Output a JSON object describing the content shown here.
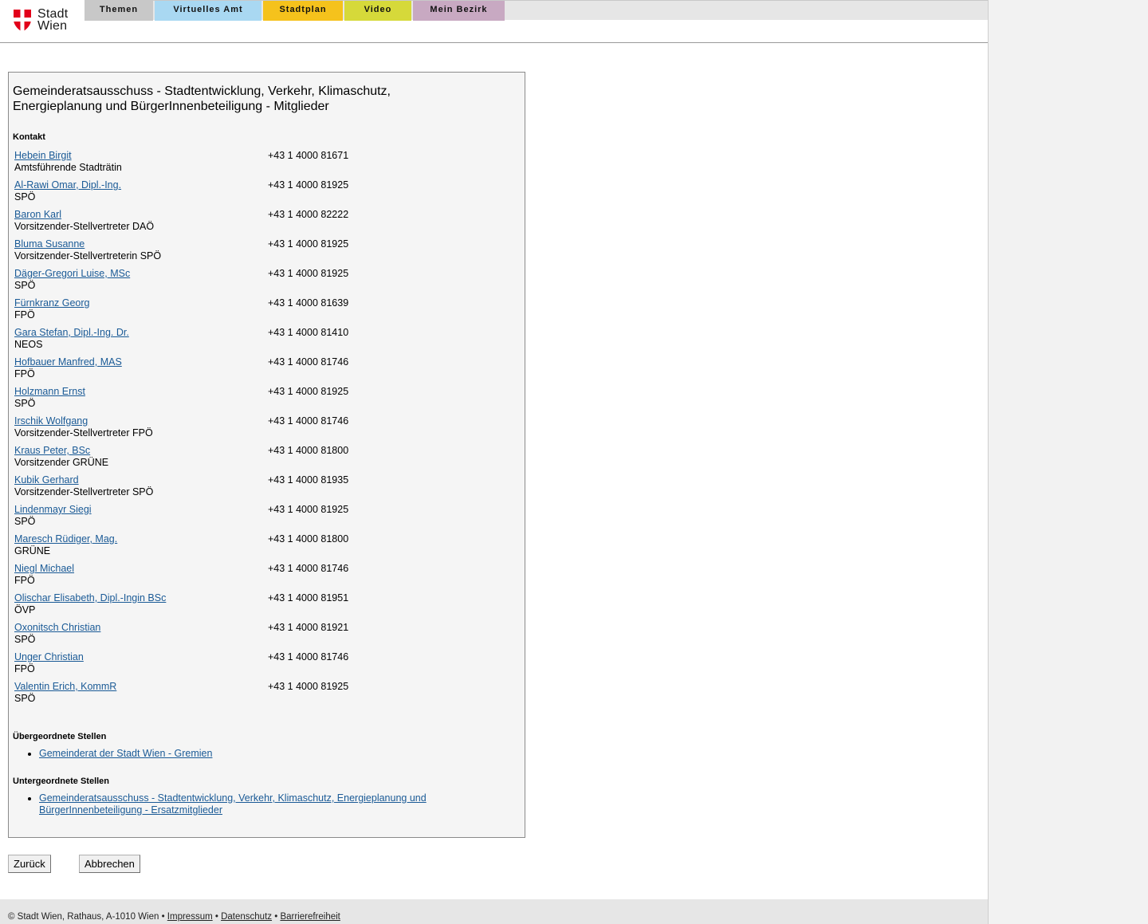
{
  "header": {
    "logo_line1": "Stadt",
    "logo_line2": "Wien",
    "brand_color": "#e2001a",
    "nav": [
      {
        "label": "Themen",
        "color": "#c8c8c8"
      },
      {
        "label": "Virtuelles Amt",
        "color": "#a9d8f2"
      },
      {
        "label": "Stadtplan",
        "color": "#f5c21c"
      },
      {
        "label": "Video",
        "color": "#d6d93a"
      },
      {
        "label": "Mein Bezirk",
        "color": "#c8a9c2"
      }
    ]
  },
  "main": {
    "title": "Gemeinderatsausschuss - Stadtentwicklung, Verkehr, Klimaschutz, Energieplanung und BürgerInnenbeteiligung - Mitglieder",
    "contact_heading": "Kontakt",
    "contacts": [
      {
        "name": "Hebein Birgit",
        "role": "Amtsführende Stadträtin",
        "phone": "+43 1 4000 81671"
      },
      {
        "name": "Al-Rawi Omar, Dipl.-Ing.",
        "role": "SPÖ",
        "phone": "+43 1 4000 81925"
      },
      {
        "name": "Baron Karl",
        "role": "Vorsitzender-Stellvertreter DAÖ",
        "phone": "+43 1 4000 82222"
      },
      {
        "name": "Bluma Susanne",
        "role": "Vorsitzender-Stellvertreterin SPÖ",
        "phone": "+43 1 4000 81925"
      },
      {
        "name": "Däger-Gregori Luise, MSc",
        "role": "SPÖ",
        "phone": "+43 1 4000 81925"
      },
      {
        "name": "Fürnkranz Georg",
        "role": "FPÖ",
        "phone": "+43 1 4000 81639"
      },
      {
        "name": "Gara Stefan, Dipl.-Ing. Dr.",
        "role": "NEOS",
        "phone": "+43 1 4000 81410"
      },
      {
        "name": "Hofbauer Manfred, MAS",
        "role": "FPÖ",
        "phone": "+43 1 4000 81746"
      },
      {
        "name": "Holzmann Ernst",
        "role": "SPÖ",
        "phone": "+43 1 4000 81925"
      },
      {
        "name": "Irschik Wolfgang",
        "role": "Vorsitzender-Stellvertreter FPÖ",
        "phone": "+43 1 4000 81746"
      },
      {
        "name": "Kraus Peter, BSc",
        "role": "Vorsitzender GRÜNE",
        "phone": "+43 1 4000 81800"
      },
      {
        "name": "Kubik Gerhard",
        "role": "Vorsitzender-Stellvertreter SPÖ",
        "phone": "+43 1 4000 81935"
      },
      {
        "name": "Lindenmayr Siegi",
        "role": "SPÖ",
        "phone": "+43 1 4000 81925"
      },
      {
        "name": "Maresch Rüdiger, Mag.",
        "role": "GRÜNE",
        "phone": "+43 1 4000 81800"
      },
      {
        "name": "Niegl Michael",
        "role": "FPÖ",
        "phone": "+43 1 4000 81746"
      },
      {
        "name": "Olischar Elisabeth, Dipl.-Ingin BSc",
        "role": "ÖVP",
        "phone": "+43 1 4000 81951"
      },
      {
        "name": "Oxonitsch Christian",
        "role": "SPÖ",
        "phone": "+43 1 4000 81921"
      },
      {
        "name": "Unger Christian",
        "role": "FPÖ",
        "phone": "+43 1 4000 81746"
      },
      {
        "name": "Valentin Erich, KommR",
        "role": "SPÖ",
        "phone": "+43 1 4000 81925"
      }
    ],
    "parent_heading": "Übergeordnete Stellen",
    "parent_links": [
      "Gemeinderat der Stadt Wien - Gremien"
    ],
    "child_heading": "Untergeordnete Stellen",
    "child_links": [
      "Gemeinderatsausschuss - Stadtentwicklung, Verkehr, Klimaschutz, Energieplanung und BürgerInnenbeteiligung - Ersatzmitglieder"
    ]
  },
  "buttons": {
    "back_label": "Zurück",
    "cancel_label": "Abbrechen"
  },
  "footer": {
    "text": "© Stadt Wien, Rathaus, A-1010 Wien",
    "links": [
      "Impressum",
      "Datenschutz",
      "Barrierefreiheit"
    ],
    "separator": " • "
  }
}
